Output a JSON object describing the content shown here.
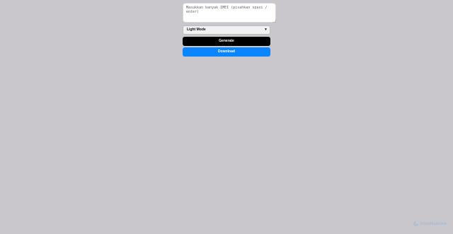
{
  "form": {
    "imei_placeholder": "Masukkan banyak IMEI (pisahkan spasi / enter)",
    "imei_value": "",
    "mode_selected": "Light Mode",
    "generate_label": "Generate",
    "download_label": "Download"
  },
  "watermark": {
    "text": "ScanMalware",
    "logo_icon": "scanmalware-logo-icon"
  },
  "colors": {
    "background": "#c9c7cc",
    "generate_button": "#000000",
    "download_button": "#0a84ff"
  }
}
